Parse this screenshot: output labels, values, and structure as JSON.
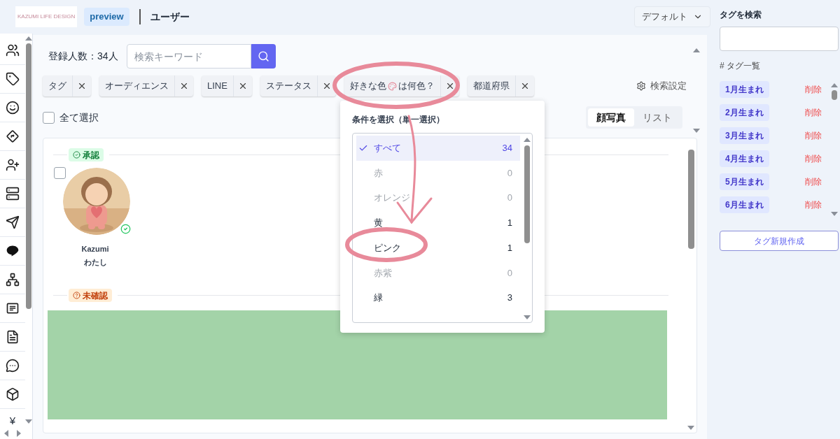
{
  "header": {
    "logo_text": "KAZUMI LIFE DESIGN",
    "badge": "preview",
    "title": "ユーザー",
    "view_select": "デフォルト"
  },
  "sidebar": {
    "currency_symbol": "¥"
  },
  "main": {
    "count_label": "登録人数：",
    "count": "34人",
    "search": {
      "placeholder": "検索キーワード"
    },
    "filters": [
      {
        "label": "タグ"
      },
      {
        "label": "オーディエンス"
      },
      {
        "label": "LINE"
      },
      {
        "label": "ステータス"
      },
      {
        "label": "好きな色",
        "label_after": "は何色？"
      },
      {
        "label": "都道府県"
      }
    ],
    "search_settings": "検索設定",
    "select_all": {
      "label": "全て選択",
      "checked": false
    },
    "view_tabs": [
      {
        "label": "顔写真",
        "selected": true
      },
      {
        "label": "リスト",
        "selected": false
      }
    ],
    "groups": [
      {
        "label": "承認",
        "kind": "approved",
        "users": [
          {
            "name": "Kazumi",
            "note": "わたし",
            "checked": false,
            "verified": true
          }
        ]
      },
      {
        "label": "未確認",
        "kind": "unconfirmed"
      }
    ]
  },
  "dropdown": {
    "title": "条件を選択（単一選択）",
    "options": [
      {
        "label": "すべて",
        "count": "34",
        "selected": true,
        "disabled": false
      },
      {
        "label": "赤",
        "count": "0",
        "selected": false,
        "disabled": true
      },
      {
        "label": "オレンジ",
        "count": "0",
        "selected": false,
        "disabled": true
      },
      {
        "label": "黄",
        "count": "1",
        "selected": false,
        "disabled": false
      },
      {
        "label": "ピンク",
        "count": "1",
        "selected": false,
        "disabled": false
      },
      {
        "label": "赤紫",
        "count": "0",
        "selected": false,
        "disabled": true
      },
      {
        "label": "緑",
        "count": "3",
        "selected": false,
        "disabled": false
      }
    ]
  },
  "tag_panel": {
    "search_label": "タグを検索",
    "list_label": "# タグ一覧",
    "tags": [
      {
        "label": "1月生まれ",
        "action": "削除"
      },
      {
        "label": "2月生まれ",
        "action": "削除"
      },
      {
        "label": "3月生まれ",
        "action": "削除"
      },
      {
        "label": "4月生まれ",
        "action": "削除"
      },
      {
        "label": "5月生まれ",
        "action": "削除"
      },
      {
        "label": "6月生まれ",
        "action": "削除"
      }
    ],
    "create_button": "タグ新規作成"
  }
}
